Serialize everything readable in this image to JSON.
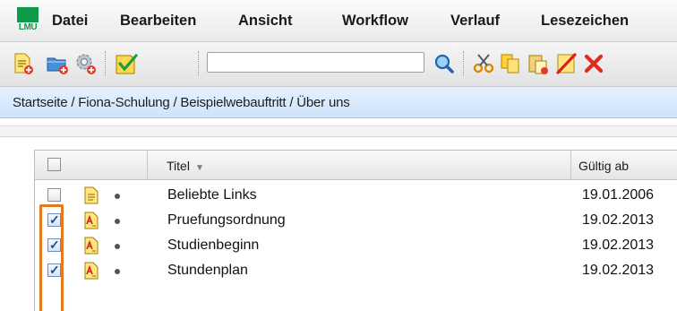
{
  "menubar": {
    "logo_text": "LMU",
    "items": [
      "Datei",
      "Bearbeiten",
      "Ansicht",
      "Workflow",
      "Verlauf",
      "Lesezeichen"
    ]
  },
  "toolbar": {
    "search_value": "",
    "icons": [
      "new-document-icon",
      "new-folder-icon",
      "new-gear-icon",
      "release-check-icon",
      "search-icon",
      "cut-icon",
      "copy-icon",
      "paste-icon",
      "no-edit-icon",
      "delete-icon"
    ]
  },
  "breadcrumb": {
    "text": "Startseite / Fiona-Schulung / Beispielwebauftritt / Über uns"
  },
  "table": {
    "columns": [
      "Titel",
      "Gültig ab"
    ],
    "sort_column": "Titel",
    "sort_direction": "descending",
    "rows": [
      {
        "title": "Beliebte Links",
        "valid_from": "19.01.2006",
        "checked": false,
        "icon": "document-icon"
      },
      {
        "title": "Pruefungsordnung",
        "valid_from": "19.02.2013",
        "checked": true,
        "icon": "edited-document-icon"
      },
      {
        "title": "Studienbeginn",
        "valid_from": "19.02.2013",
        "checked": true,
        "icon": "edited-document-icon"
      },
      {
        "title": "Stundenplan",
        "valid_from": "19.02.2013",
        "checked": true,
        "icon": "edited-document-icon"
      }
    ]
  },
  "colors": {
    "logo_green": "#0f9a49",
    "breadcrumb_bg": "#d9eafc",
    "highlight": "#e6781f"
  }
}
